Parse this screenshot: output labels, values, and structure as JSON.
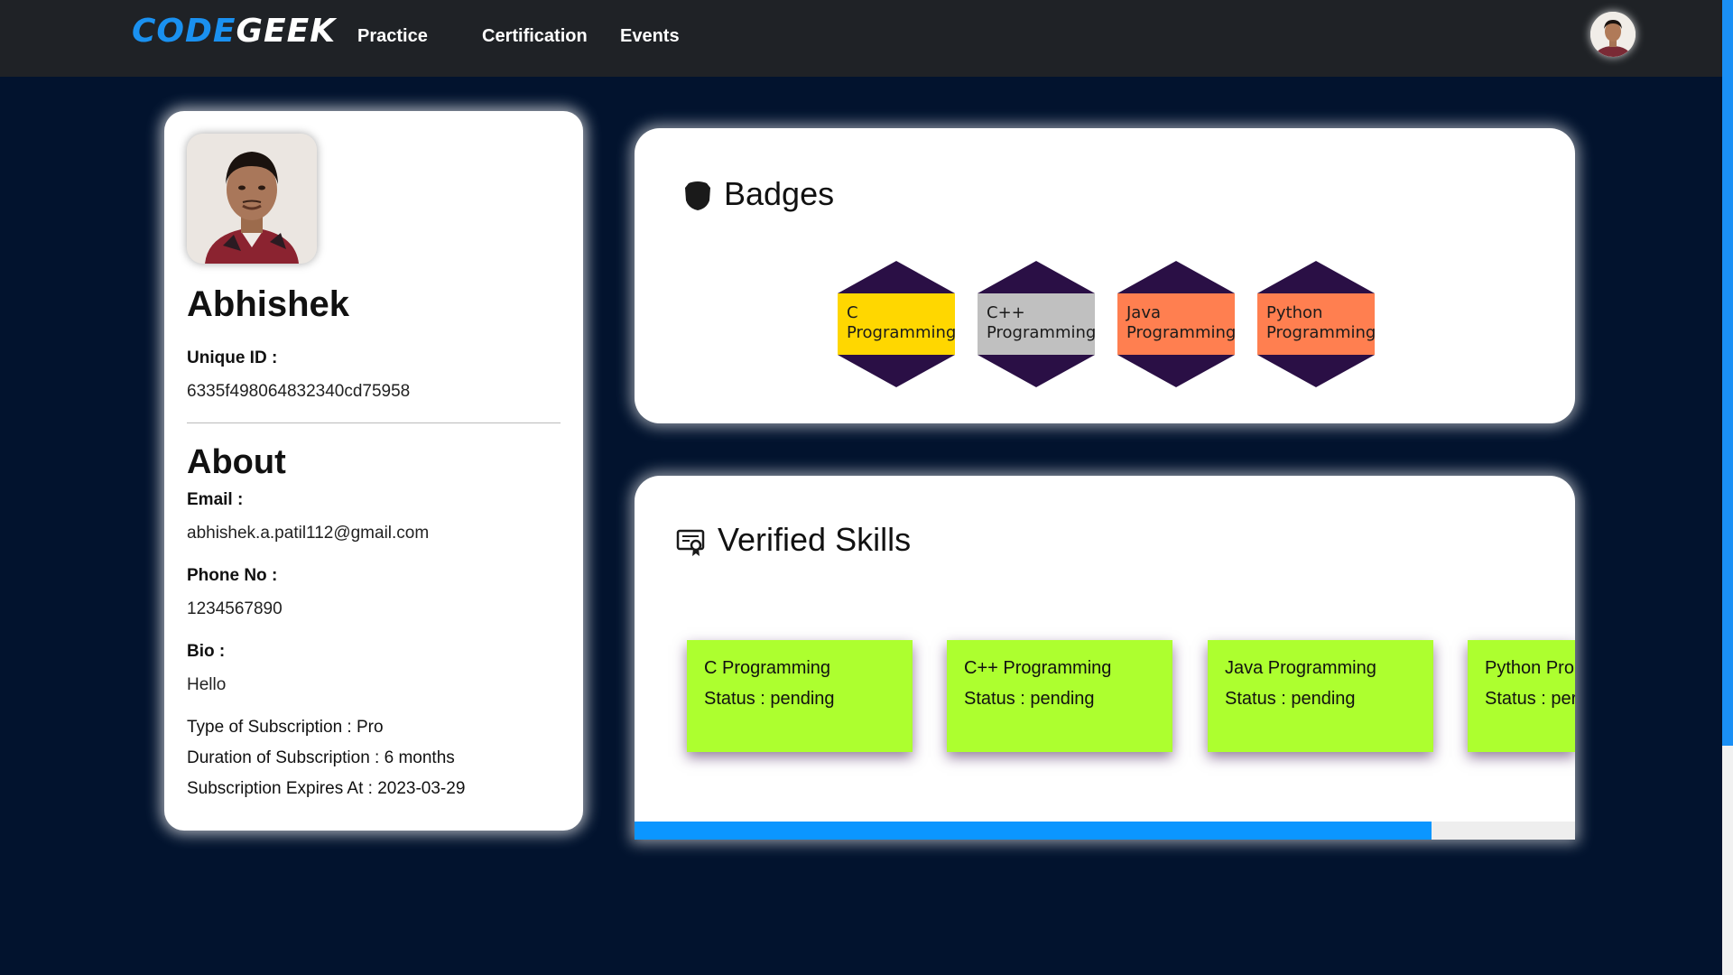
{
  "navbar": {
    "brand_part1": "CODE",
    "brand_part2": "GEEK",
    "links": [
      "Practice",
      "Certification",
      "Events"
    ]
  },
  "profile": {
    "name": "Abhishek",
    "unique_id_label": "Unique ID :",
    "unique_id": "6335f498064832340cd75958",
    "about_heading": "About",
    "email_label": "Email :",
    "email": "abhishek.a.patil112@gmail.com",
    "phone_label": "Phone No :",
    "phone": "1234567890",
    "bio_label": "Bio :",
    "bio": "Hello",
    "subscription_type": "Type of Subscription : Pro",
    "subscription_duration": "Duration of Subscription : 6 months",
    "subscription_expires": "Subscription Expires At : 2023-03-29"
  },
  "badges": {
    "title": "Badges",
    "icon": "shield-icon",
    "items": [
      {
        "line1": "C",
        "line2": "Programming",
        "color": "#ffd700"
      },
      {
        "line1": "C++",
        "line2": "Programming",
        "color": "#c0c0c0"
      },
      {
        "line1": "Java",
        "line2": "Programming",
        "color": "#ff7f50"
      },
      {
        "line1": "Python",
        "line2": "Programming",
        "color": "#ff7f50"
      }
    ],
    "hex_color": "#2a0f45"
  },
  "skills": {
    "title": "Verified Skills",
    "icon": "certificate-icon",
    "items": [
      {
        "name": "C Programming",
        "status": "Status : pending"
      },
      {
        "name": "C++ Programming",
        "status": "Status : pending"
      },
      {
        "name": "Java Programming",
        "status": "Status : pending"
      },
      {
        "name": "Python Pro",
        "status": "Status : per"
      }
    ],
    "card_color": "#adff2f",
    "scroll_position": 0.85
  },
  "colors": {
    "page_bg": "#02132e",
    "navbar_bg": "#1f2226",
    "brand_blue": "#1a91f0",
    "scroll_blue": "#0b96ff"
  }
}
